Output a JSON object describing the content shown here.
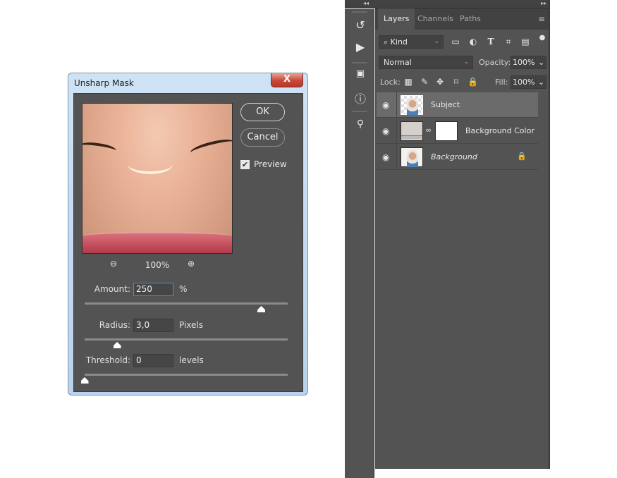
{
  "dialog": {
    "title": "Unsharp Mask",
    "close_label": "X",
    "ok_label": "OK",
    "cancel_label": "Cancel",
    "preview_label": "Preview",
    "preview_checked": true,
    "zoom_level": "100%",
    "amount": {
      "label": "Amount:",
      "value": "250",
      "unit": "%",
      "slider_fraction": 0.87
    },
    "radius": {
      "label": "Radius:",
      "value": "3,0",
      "unit": "Pixels",
      "slider_fraction": 0.16
    },
    "threshold": {
      "label": "Threshold:",
      "value": "0",
      "unit": "levels",
      "slider_fraction": 0.0
    }
  },
  "panel": {
    "collapse_left": "◂◂",
    "collapse_right": "▸▸",
    "tabs": [
      {
        "label": "Layers",
        "active": true
      },
      {
        "label": "Channels",
        "active": false
      },
      {
        "label": "Paths",
        "active": false
      }
    ],
    "filter_kind": "Kind",
    "blend_mode": "Normal",
    "opacity_label": "Opacity:",
    "opacity_value": "100%",
    "lock_label": "Lock:",
    "fill_label": "Fill:",
    "fill_value": "100%",
    "layers": [
      {
        "name": "Subject",
        "selected": true,
        "visible": true,
        "locked": false
      },
      {
        "name": "Background Color",
        "selected": false,
        "visible": true,
        "locked": false
      },
      {
        "name": "Background",
        "selected": false,
        "visible": true,
        "locked": true
      }
    ]
  },
  "icons": {
    "zoom_out": "⊖",
    "zoom_in": "⊕",
    "check": "✔",
    "eye": "◉",
    "lock": "🔒",
    "chain": "∞",
    "chevron_down": "⌄",
    "menu": "≡",
    "search": "⌕",
    "history": "↺",
    "play": "▶",
    "info": "ⓘ",
    "type": "T"
  }
}
